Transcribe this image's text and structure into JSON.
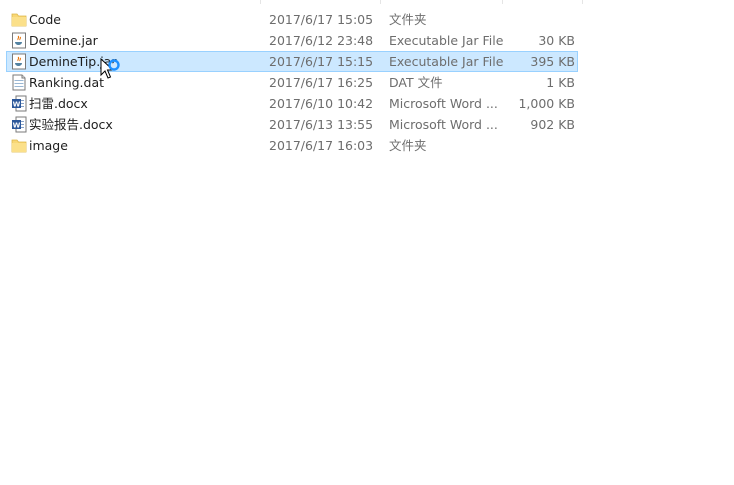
{
  "files": [
    {
      "name": "Code",
      "date": "2017/6/17 15:05",
      "type": "文件夹",
      "size": "",
      "icon": "folder-icon"
    },
    {
      "name": "Demine.jar",
      "date": "2017/6/12 23:48",
      "type": "Executable Jar File",
      "size": "30 KB",
      "icon": "java-jar-icon"
    },
    {
      "name": "DemineTip.jar",
      "date": "2017/6/17 15:15",
      "type": "Executable Jar File",
      "size": "395 KB",
      "icon": "java-jar-icon",
      "selected": true
    },
    {
      "name": "Ranking.dat",
      "date": "2017/6/17 16:25",
      "type": "DAT 文件",
      "size": "1 KB",
      "icon": "dat-file-icon"
    },
    {
      "name": "扫雷.docx",
      "date": "2017/6/10 10:42",
      "type": "Microsoft Word ...",
      "size": "1,000 KB",
      "icon": "word-doc-icon"
    },
    {
      "name": "实验报告.docx",
      "date": "2017/6/13 13:55",
      "type": "Microsoft Word ...",
      "size": "902 KB",
      "icon": "word-doc-icon"
    },
    {
      "name": "image",
      "date": "2017/6/17 16:03",
      "type": "文件夹",
      "size": "",
      "icon": "folder-icon"
    }
  ],
  "colors": {
    "selection": "#cce8ff",
    "selection_border": "#99d1ff",
    "folder": "#f8d775"
  }
}
